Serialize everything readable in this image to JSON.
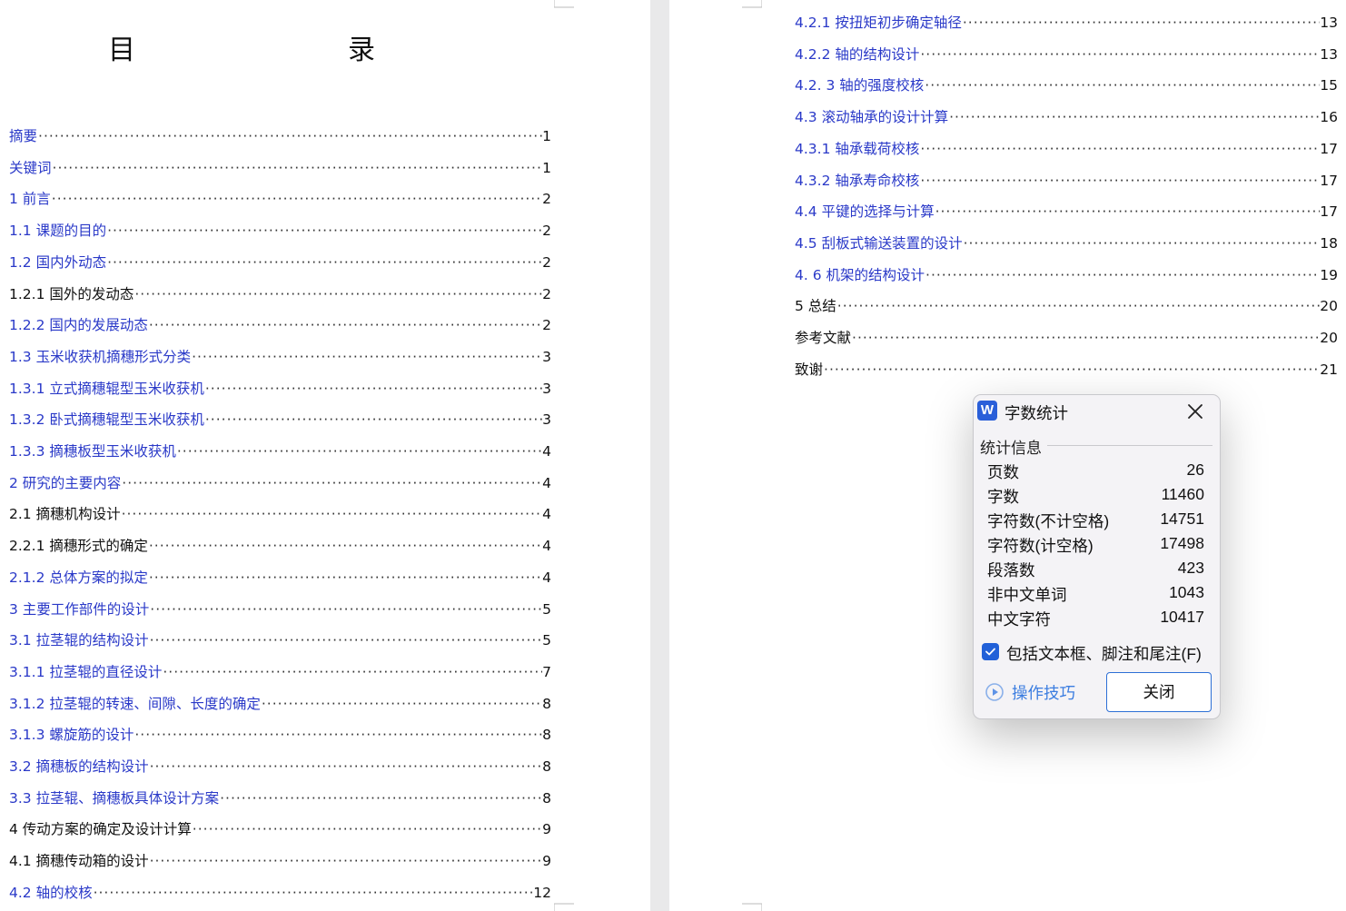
{
  "document": {
    "title": "目　　录",
    "left_toc": [
      {
        "text": "摘要",
        "page": "1",
        "link": true
      },
      {
        "text": "关键词",
        "page": "1",
        "link": true
      },
      {
        "text": "1 前言",
        "page": "2",
        "link": true
      },
      {
        "text": "1.1 课题的目的",
        "page": "2",
        "link": true
      },
      {
        "text": "1.2 国内外动态",
        "page": "2",
        "link": true
      },
      {
        "text": "1.2.1 国外的发动态",
        "page": "2",
        "link": false
      },
      {
        "text": "1.2.2 国内的发展动态",
        "page": "2",
        "link": true
      },
      {
        "text": "1.3 玉米收获机摘穗形式分类",
        "page": "3",
        "link": true
      },
      {
        "text": "1.3.1 立式摘穗辊型玉米收获机",
        "page": "3",
        "link": true
      },
      {
        "text": "1.3.2 卧式摘穗辊型玉米收获机",
        "page": "3",
        "link": true
      },
      {
        "text": "1.3.3 摘穗板型玉米收获机",
        "page": "4",
        "link": true
      },
      {
        "text": "2 研究的主要内容",
        "page": "4",
        "link": true
      },
      {
        "text": "2.1 摘穗机构设计",
        "page": "4",
        "link": false
      },
      {
        "text": "2.2.1  摘穗形式的确定",
        "page": "4",
        "link": false
      },
      {
        "text": "2.1.2 总体方案的拟定",
        "page": "4",
        "link": true
      },
      {
        "text": "3 主要工作部件的设计",
        "page": "5",
        "link": true
      },
      {
        "text": "3.1 拉茎辊的结构设计",
        "page": "5",
        "link": true
      },
      {
        "text": "3.1.1 拉茎辊的直径设计",
        "page": "7",
        "link": true
      },
      {
        "text": "3.1.2 拉茎辊的转速、间隙、长度的确定",
        "page": "8",
        "link": true
      },
      {
        "text": "3.1.3 螺旋筋的设计",
        "page": "8",
        "link": true
      },
      {
        "text": "3.2 摘穗板的结构设计",
        "page": "8",
        "link": true
      },
      {
        "text": "3.3 拉茎辊、摘穗板具体设计方案",
        "page": "8",
        "link": true
      },
      {
        "text": "4 传动方案的确定及设计计算",
        "page": "9",
        "link": false
      },
      {
        "text": "4.1 摘穗传动箱的设计",
        "page": "9",
        "link": false
      },
      {
        "text": "4.2 轴的校核",
        "page": "12",
        "link": true
      }
    ],
    "right_toc": [
      {
        "text": "4.2.1 按扭矩初步确定轴径",
        "page": "13",
        "link": true
      },
      {
        "text": "4.2.2 轴的结构设计",
        "page": "13",
        "link": true
      },
      {
        "text": "4.2. 3 轴的强度校核",
        "page": "15",
        "link": true
      },
      {
        "text": "4.3 滚动轴承的设计计算",
        "page": "16",
        "link": true
      },
      {
        "text": "4.3.1 轴承载荷校核",
        "page": "17",
        "link": true
      },
      {
        "text": "4.3.2 轴承寿命校核",
        "page": "17",
        "link": true
      },
      {
        "text": "4.4 平键的选择与计算",
        "page": "17",
        "link": true
      },
      {
        "text": "4.5 刮板式输送装置的设计",
        "page": "18",
        "link": true
      },
      {
        "text": "4. 6 机架的结构设计",
        "page": "19",
        "link": true
      },
      {
        "text": "5 总结",
        "page": "20",
        "link": false
      },
      {
        "text": "参考文献",
        "page": "20",
        "link": false
      },
      {
        "text": "致谢",
        "page": "21",
        "link": false
      }
    ]
  },
  "dialog": {
    "app_icon": "W",
    "title": "字数统计",
    "section": "统计信息",
    "stats": [
      {
        "label": "页数",
        "value": "26"
      },
      {
        "label": "字数",
        "value": "11460"
      },
      {
        "label": "字符数(不计空格)",
        "value": "14751"
      },
      {
        "label": "字符数(计空格)",
        "value": "17498"
      },
      {
        "label": "段落数",
        "value": "423"
      },
      {
        "label": "非中文单词",
        "value": "1043"
      },
      {
        "label": "中文字符",
        "value": "10417"
      }
    ],
    "checkbox_label": "包括文本框、脚注和尾注(F)",
    "checkbox_checked": true,
    "tips_label": "操作技巧",
    "close_label": "关闭"
  },
  "colors": {
    "link": "#2a39c8",
    "accent": "#2160d8",
    "tips": "#3b7de0"
  }
}
